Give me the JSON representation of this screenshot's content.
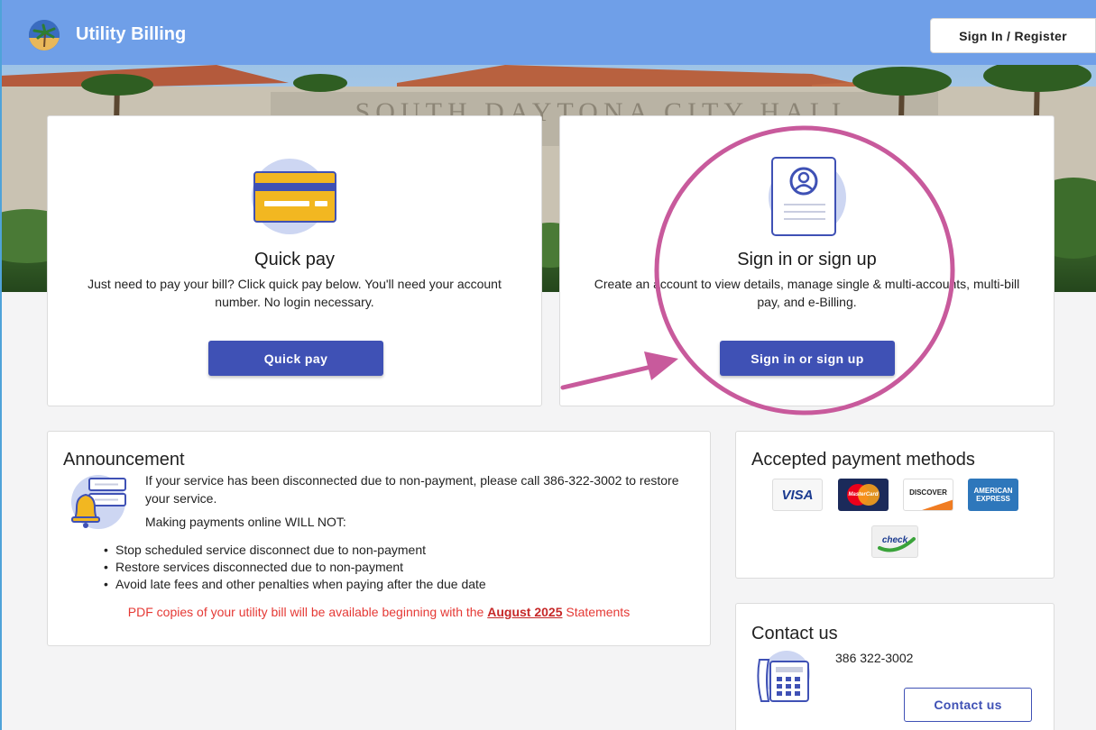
{
  "header": {
    "title": "Utility Billing",
    "signin_label": "Sign In / Register"
  },
  "hero": {
    "building_sign": "SOUTH DAYTONA CITY HALL"
  },
  "quick_pay": {
    "title": "Quick pay",
    "description": "Just need to pay your bill? Click quick pay below. You'll need your account number. No login necessary.",
    "button_label": "Quick pay"
  },
  "sign_in": {
    "title": "Sign in or sign up",
    "description": "Create an account to view details, manage single & multi-accounts, multi-bill pay, and e-Billing.",
    "button_label": "Sign in or sign up"
  },
  "announcement": {
    "title": "Announcement",
    "line1": "If your service has been disconnected due to non-payment, please call 386-322-3002 to restore your service.",
    "line2": "Making payments online WILL NOT:",
    "bullets": [
      "Stop scheduled service disconnect due to non-payment",
      "Restore services disconnected due to non-payment",
      "Avoid late fees and other penalties when paying after the due date"
    ],
    "note_prefix": "PDF copies of your utility bill will be available beginning with the ",
    "note_link": "August 2025",
    "note_suffix": " Statements"
  },
  "payment_methods": {
    "title": "Accepted payment methods",
    "methods": [
      {
        "name": "VISA",
        "icon": "visa-card-icon"
      },
      {
        "name": "MasterCard",
        "icon": "mastercard-card-icon"
      },
      {
        "name": "DISCOVER",
        "icon": "discover-card-icon"
      },
      {
        "name": "AMERICAN EXPRESS",
        "icon": "amex-card-icon"
      },
      {
        "name": "check",
        "icon": "echeck-icon"
      }
    ]
  },
  "contact": {
    "title": "Contact us",
    "phone": "386 322-3002",
    "button_label": "Contact us"
  },
  "colors": {
    "header": "#6f9fe8",
    "primary_button": "#3f51b5",
    "annotation": "#c85a9c",
    "note_red": "#e53935"
  }
}
